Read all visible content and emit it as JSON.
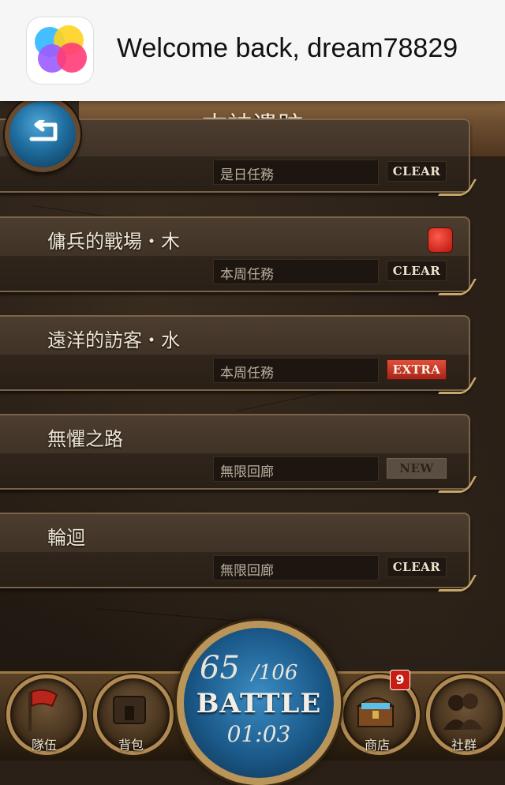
{
  "game_center": {
    "message": "Welcome back, dream78829",
    "icon": "game-center-icon"
  },
  "header": {
    "title": "古神遺跡",
    "back_icon": "back-arrow-icon"
  },
  "quests": [
    {
      "title": "",
      "subtitle": "是日任務",
      "badge": "CLEAR",
      "badge_type": "clear"
    },
    {
      "title": "傭兵的戰場・木",
      "subtitle": "本周任務",
      "badge": "CLEAR",
      "badge_type": "clear",
      "corner_icon": "wood-element-icon"
    },
    {
      "title": "遠洋的訪客・水",
      "subtitle": "本周任務",
      "badge": "EXTRA",
      "badge_type": "extra"
    },
    {
      "title": "無懼之路",
      "subtitle": "無限回廊",
      "badge": "NEW",
      "badge_type": "new"
    },
    {
      "title": "輪迴",
      "subtitle": "無限回廊",
      "badge": "CLEAR",
      "badge_type": "clear"
    }
  ],
  "bottom_nav": {
    "team": {
      "label": "隊伍",
      "icon": "flag-icon"
    },
    "bag": {
      "label": "背包",
      "icon": "backpack-icon"
    },
    "shop": {
      "label": "商店",
      "icon": "treasure-chest-icon",
      "badge": "9"
    },
    "social": {
      "label": "社群",
      "icon": "people-icon"
    }
  },
  "battle": {
    "stamina": "65",
    "stamina_max": "/106",
    "label": "BATTLE",
    "timer": "01:03"
  },
  "colors": {
    "clear_badge": "#1f1812",
    "extra_badge": "#c0392b",
    "battle_blue": "#1b5a8a",
    "gold_trim": "#c9a86c"
  }
}
